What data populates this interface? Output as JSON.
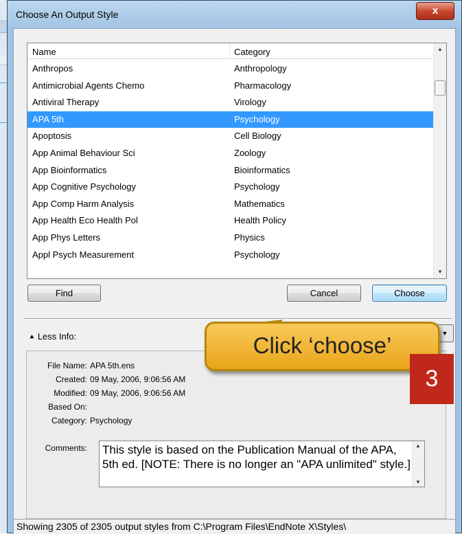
{
  "window": {
    "title": "Choose An Output Style",
    "close_glyph": "x"
  },
  "list": {
    "columns": [
      "Name",
      "Category"
    ],
    "rows": [
      {
        "name": "Anthropos",
        "category": "Anthropology"
      },
      {
        "name": "Antimicrobial Agents Chemo",
        "category": "Pharmacology"
      },
      {
        "name": "Antiviral Therapy",
        "category": "Virology"
      },
      {
        "name": "APA 5th",
        "category": "Psychology",
        "selected": true
      },
      {
        "name": "Apoptosis",
        "category": "Cell Biology"
      },
      {
        "name": "App Animal Behaviour Sci",
        "category": "Zoology"
      },
      {
        "name": "App Bioinformatics",
        "category": "Bioinformatics"
      },
      {
        "name": "App Cognitive Psychology",
        "category": "Psychology"
      },
      {
        "name": "App Comp Harm Analysis",
        "category": "Mathematics"
      },
      {
        "name": "App Health Eco Health Pol",
        "category": "Health Policy"
      },
      {
        "name": "App Phys Letters",
        "category": "Physics"
      },
      {
        "name": "Appl Psych Measurement",
        "category": "Psychology"
      }
    ]
  },
  "buttons": {
    "find": "Find",
    "cancel": "Cancel",
    "choose": "Choose"
  },
  "less_info": "Less Info:",
  "info": {
    "file_name_label": "File Name:",
    "file_name": "APA 5th.ens",
    "created_label": "Created:",
    "created": "09 May, 2006, 9:06:56 AM",
    "modified_label": "Modified:",
    "modified": "09 May, 2006, 9:06:56 AM",
    "based_on_label": "Based On:",
    "based_on": "",
    "category_label": "Category:",
    "category": "Psychology",
    "comments_label": "Comments:",
    "comments": "This style is based on the Publication Manual of the APA, 5th ed.  [NOTE: There is no longer an \"APA unlimited\" style.]"
  },
  "status": "Showing 2305 of 2305 output styles from C:\\Program Files\\EndNote X\\Styles\\",
  "callout": {
    "text": "Click ‘choose’",
    "step": "3"
  },
  "colors": {
    "selection": "#3399ff",
    "callout": "#f0b535",
    "badge": "#c0281c"
  }
}
